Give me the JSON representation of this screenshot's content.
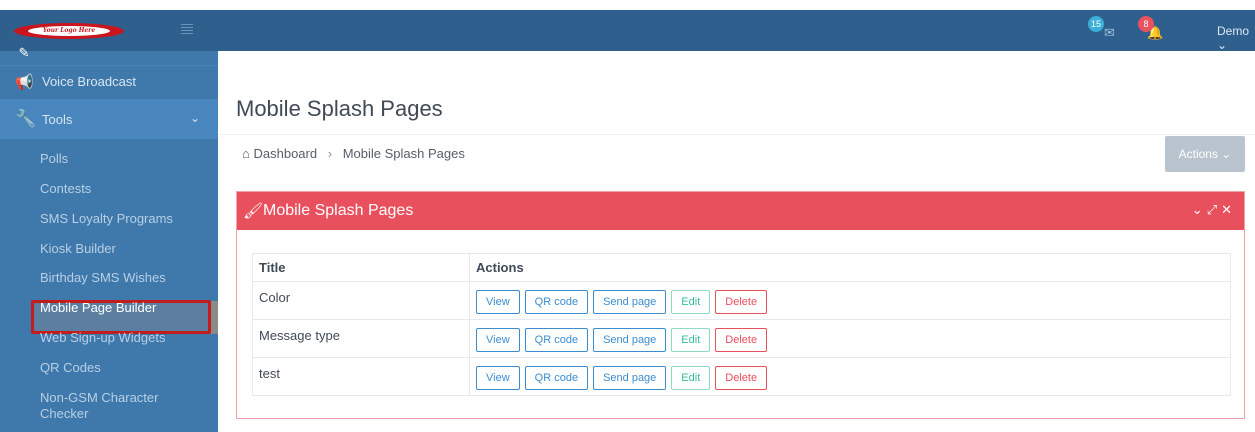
{
  "logo": {
    "text": "Your Logo Here"
  },
  "topbar": {
    "messages_count": "15",
    "notifications_count": "8",
    "user_label": "Demo ⌄"
  },
  "sidebar": {
    "voice_broadcast": "Voice Broadcast",
    "tools": "Tools",
    "tools_items": [
      "Polls",
      "Contests",
      "SMS Loyalty Programs",
      "Kiosk Builder",
      "Birthday SMS Wishes",
      "Mobile Page Builder",
      "Web Sign-up Widgets",
      "QR Codes",
      "Non-GSM Character",
      "Checker"
    ]
  },
  "page": {
    "title": "Mobile Splash Pages",
    "breadcrumb_home": "Dashboard",
    "breadcrumb_current": "Mobile Splash Pages",
    "actions_label": "Actions ⌄"
  },
  "card": {
    "title": "Mobile Splash Pages",
    "columns": [
      "Title",
      "Actions"
    ],
    "rows": [
      {
        "title": "Color"
      },
      {
        "title": "Message type"
      },
      {
        "title": "test"
      }
    ],
    "buttons": {
      "view": "View",
      "qr": "QR code",
      "send": "Send page",
      "edit": "Edit",
      "delete": "Delete"
    }
  },
  "colors": {
    "sidebar": "#3f78ab",
    "topbar": "#2f5f8c",
    "card_header": "#e9505d",
    "highlight_border": "#c21d1d"
  }
}
